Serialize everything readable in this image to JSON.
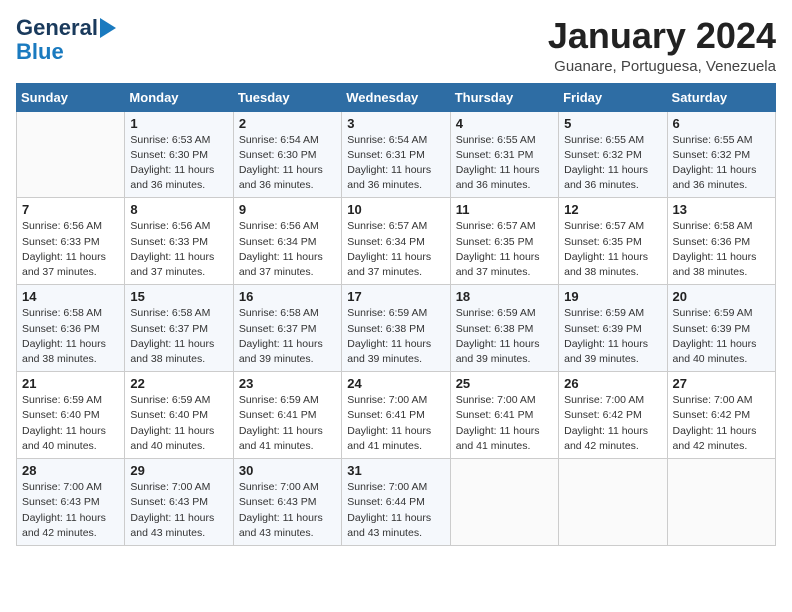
{
  "logo": {
    "line1": "General",
    "line2": "Blue"
  },
  "title": "January 2024",
  "subtitle": "Guanare, Portuguesa, Venezuela",
  "days_of_week": [
    "Sunday",
    "Monday",
    "Tuesday",
    "Wednesday",
    "Thursday",
    "Friday",
    "Saturday"
  ],
  "weeks": [
    [
      {
        "day": "",
        "info": ""
      },
      {
        "day": "1",
        "info": "Sunrise: 6:53 AM\nSunset: 6:30 PM\nDaylight: 11 hours\nand 36 minutes."
      },
      {
        "day": "2",
        "info": "Sunrise: 6:54 AM\nSunset: 6:30 PM\nDaylight: 11 hours\nand 36 minutes."
      },
      {
        "day": "3",
        "info": "Sunrise: 6:54 AM\nSunset: 6:31 PM\nDaylight: 11 hours\nand 36 minutes."
      },
      {
        "day": "4",
        "info": "Sunrise: 6:55 AM\nSunset: 6:31 PM\nDaylight: 11 hours\nand 36 minutes."
      },
      {
        "day": "5",
        "info": "Sunrise: 6:55 AM\nSunset: 6:32 PM\nDaylight: 11 hours\nand 36 minutes."
      },
      {
        "day": "6",
        "info": "Sunrise: 6:55 AM\nSunset: 6:32 PM\nDaylight: 11 hours\nand 36 minutes."
      }
    ],
    [
      {
        "day": "7",
        "info": "Sunrise: 6:56 AM\nSunset: 6:33 PM\nDaylight: 11 hours\nand 37 minutes."
      },
      {
        "day": "8",
        "info": "Sunrise: 6:56 AM\nSunset: 6:33 PM\nDaylight: 11 hours\nand 37 minutes."
      },
      {
        "day": "9",
        "info": "Sunrise: 6:56 AM\nSunset: 6:34 PM\nDaylight: 11 hours\nand 37 minutes."
      },
      {
        "day": "10",
        "info": "Sunrise: 6:57 AM\nSunset: 6:34 PM\nDaylight: 11 hours\nand 37 minutes."
      },
      {
        "day": "11",
        "info": "Sunrise: 6:57 AM\nSunset: 6:35 PM\nDaylight: 11 hours\nand 37 minutes."
      },
      {
        "day": "12",
        "info": "Sunrise: 6:57 AM\nSunset: 6:35 PM\nDaylight: 11 hours\nand 38 minutes."
      },
      {
        "day": "13",
        "info": "Sunrise: 6:58 AM\nSunset: 6:36 PM\nDaylight: 11 hours\nand 38 minutes."
      }
    ],
    [
      {
        "day": "14",
        "info": "Sunrise: 6:58 AM\nSunset: 6:36 PM\nDaylight: 11 hours\nand 38 minutes."
      },
      {
        "day": "15",
        "info": "Sunrise: 6:58 AM\nSunset: 6:37 PM\nDaylight: 11 hours\nand 38 minutes."
      },
      {
        "day": "16",
        "info": "Sunrise: 6:58 AM\nSunset: 6:37 PM\nDaylight: 11 hours\nand 39 minutes."
      },
      {
        "day": "17",
        "info": "Sunrise: 6:59 AM\nSunset: 6:38 PM\nDaylight: 11 hours\nand 39 minutes."
      },
      {
        "day": "18",
        "info": "Sunrise: 6:59 AM\nSunset: 6:38 PM\nDaylight: 11 hours\nand 39 minutes."
      },
      {
        "day": "19",
        "info": "Sunrise: 6:59 AM\nSunset: 6:39 PM\nDaylight: 11 hours\nand 39 minutes."
      },
      {
        "day": "20",
        "info": "Sunrise: 6:59 AM\nSunset: 6:39 PM\nDaylight: 11 hours\nand 40 minutes."
      }
    ],
    [
      {
        "day": "21",
        "info": "Sunrise: 6:59 AM\nSunset: 6:40 PM\nDaylight: 11 hours\nand 40 minutes."
      },
      {
        "day": "22",
        "info": "Sunrise: 6:59 AM\nSunset: 6:40 PM\nDaylight: 11 hours\nand 40 minutes."
      },
      {
        "day": "23",
        "info": "Sunrise: 6:59 AM\nSunset: 6:41 PM\nDaylight: 11 hours\nand 41 minutes."
      },
      {
        "day": "24",
        "info": "Sunrise: 7:00 AM\nSunset: 6:41 PM\nDaylight: 11 hours\nand 41 minutes."
      },
      {
        "day": "25",
        "info": "Sunrise: 7:00 AM\nSunset: 6:41 PM\nDaylight: 11 hours\nand 41 minutes."
      },
      {
        "day": "26",
        "info": "Sunrise: 7:00 AM\nSunset: 6:42 PM\nDaylight: 11 hours\nand 42 minutes."
      },
      {
        "day": "27",
        "info": "Sunrise: 7:00 AM\nSunset: 6:42 PM\nDaylight: 11 hours\nand 42 minutes."
      }
    ],
    [
      {
        "day": "28",
        "info": "Sunrise: 7:00 AM\nSunset: 6:43 PM\nDaylight: 11 hours\nand 42 minutes."
      },
      {
        "day": "29",
        "info": "Sunrise: 7:00 AM\nSunset: 6:43 PM\nDaylight: 11 hours\nand 43 minutes."
      },
      {
        "day": "30",
        "info": "Sunrise: 7:00 AM\nSunset: 6:43 PM\nDaylight: 11 hours\nand 43 minutes."
      },
      {
        "day": "31",
        "info": "Sunrise: 7:00 AM\nSunset: 6:44 PM\nDaylight: 11 hours\nand 43 minutes."
      },
      {
        "day": "",
        "info": ""
      },
      {
        "day": "",
        "info": ""
      },
      {
        "day": "",
        "info": ""
      }
    ]
  ]
}
